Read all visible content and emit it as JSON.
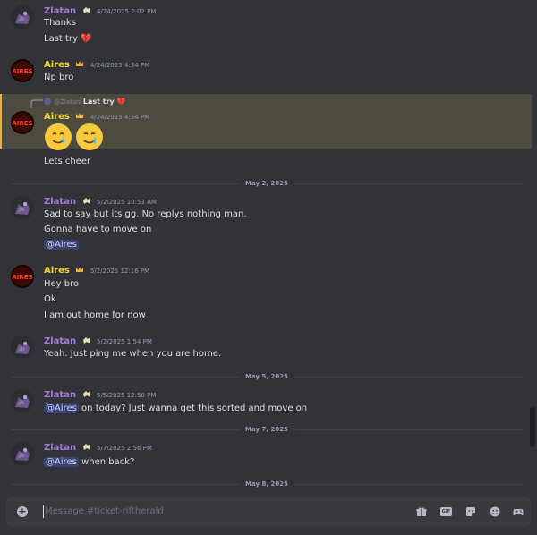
{
  "colors": {
    "background": "#313338",
    "zlatan": "#a67cd6",
    "aires": "#f0d52b",
    "mention": "#3c4270",
    "highlight": "#4d4a40",
    "highlight_bar": "#f0b232"
  },
  "messages": [
    {
      "author": "Zlatan",
      "timestamp": "4/24/2025 2:02 PM",
      "lines": [
        "Thanks",
        "Last try 💔"
      ]
    },
    {
      "author": "Aires",
      "timestamp": "4/24/2025 4:34 PM",
      "lines": [
        "Np bro"
      ]
    },
    {
      "reply_author": "@Zlatan",
      "reply_text": "Last try 💔",
      "author": "Aires",
      "timestamp": "4/24/2025 4:34 PM",
      "emoji": [
        "🥲",
        "🥲"
      ],
      "lines": [
        "Lets cheer"
      ]
    }
  ],
  "dividers": [
    "May 2, 2025",
    "May 5, 2025",
    "May 7, 2025",
    "May 8, 2025"
  ],
  "may2": [
    {
      "author": "Zlatan",
      "timestamp": "5/2/2025 10:53 AM",
      "lines": [
        "Sad to say but its gg. No replys nothing man.",
        "Gonna have to move on"
      ],
      "mention": "@Aires"
    },
    {
      "author": "Aires",
      "timestamp": "5/2/2025 12:16 PM",
      "lines": [
        "Hey bro",
        "Ok",
        "I am out home for now"
      ]
    },
    {
      "author": "Zlatan",
      "timestamp": "5/2/2025 1:54 PM",
      "lines": [
        "Yeah. Just ping me when you are home."
      ]
    }
  ],
  "may5": {
    "author": "Zlatan",
    "timestamp": "5/5/2025 12:50 PM",
    "mention": "@Aires",
    "text": " on today? Just wanna get this sorted and move on"
  },
  "may7": {
    "author": "Zlatan",
    "timestamp": "5/7/2025 2:56 PM",
    "mention": "@Aires",
    "text": " when back?"
  },
  "composer": {
    "placeholder": "Message #ticket-riftherald",
    "gif_label": "GIF"
  },
  "icons": {
    "zlatan_badge": "flower-badge-icon",
    "aires_badge": "crown-icon",
    "avatar_aires_text": "AIRES"
  }
}
